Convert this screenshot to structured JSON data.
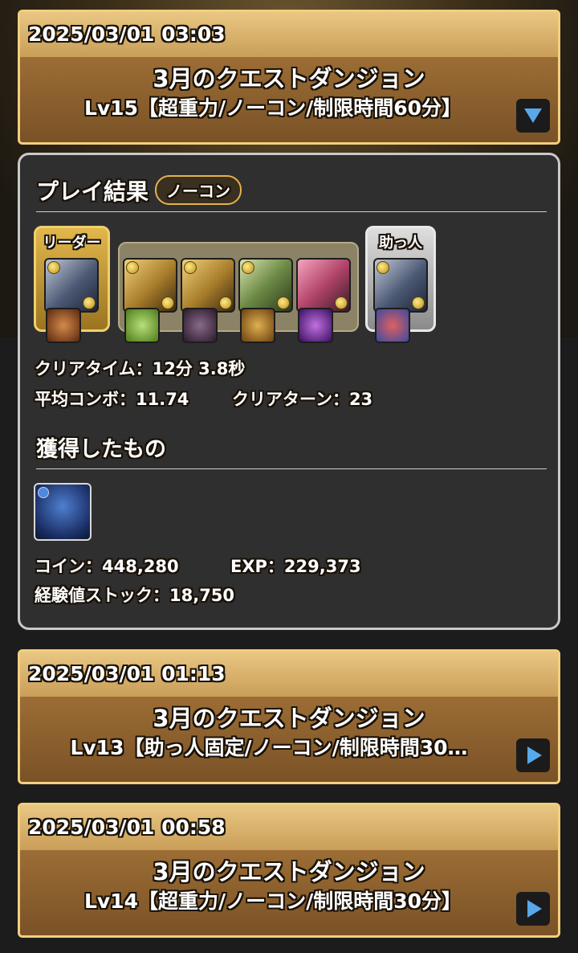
{
  "entries": [
    {
      "date": "2025/03/01 03:03",
      "title": "3月のクエストダンジョン",
      "subtitle": "Lv15【超重力/ノーコン/制限時間60分】",
      "expanded": true,
      "toggle_icon": "triangle-down-icon"
    },
    {
      "date": "2025/03/01 01:13",
      "title": "3月のクエストダンジョン",
      "subtitle": "Lv13【助っ人固定/ノーコン/制限時間30…",
      "expanded": false,
      "toggle_icon": "triangle-right-icon"
    },
    {
      "date": "2025/03/01 00:58",
      "title": "3月のクエストダンジョン",
      "subtitle": "Lv14【超重力/ノーコン/制限時間30分】",
      "expanded": false,
      "toggle_icon": "triangle-right-icon"
    }
  ],
  "result": {
    "heading": "プレイ結果",
    "badge": "ノーコン",
    "leader_label": "リーダー",
    "helper_label": "助っ人",
    "clear_time": "クリアタイム：12分 3.8秒",
    "avg_combo": "平均コンボ：11.74",
    "clear_turns": "クリアターン：23",
    "obtained_heading": "獲得したもの",
    "coins": "コイン：448,280",
    "exp": "EXP：229,373",
    "exp_stock": "経験値ストック：18,750"
  },
  "colors": {
    "gold_border": "#f2cf7e",
    "panel_bg": "#2f2f2f",
    "toggle_arrow": "#58a8ea",
    "leader_frame": "#d4a93a",
    "helper_frame": "#bdbdbd"
  }
}
